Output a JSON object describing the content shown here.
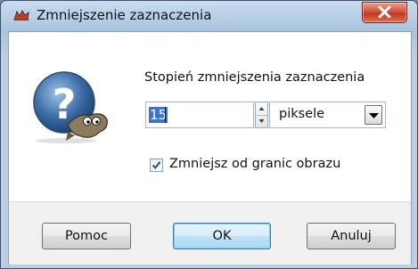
{
  "window": {
    "title": "Zmniejszenie zaznaczenia"
  },
  "icons": {
    "app": "gimp-app-icon",
    "close": "close-icon",
    "help": "help-question-wilber-icon",
    "spin": "spin-arrows-icon",
    "dropdown": "chevron-down-icon",
    "check": "checkmark-icon"
  },
  "dialog": {
    "heading": "Stopień zmniejszenia zaznaczenia",
    "amount_value": "15",
    "unit_value": "piksele",
    "checkbox_label": "Zmniejsz od granic obrazu",
    "checkbox_checked": true
  },
  "buttons": {
    "help": "Pomoc",
    "ok": "OK",
    "cancel": "Anuluj"
  },
  "colors": {
    "title_bar": "#a9c4df",
    "close_button": "#c13a22",
    "selection": "#3b74c8",
    "default_button": "#bfe2f6"
  }
}
